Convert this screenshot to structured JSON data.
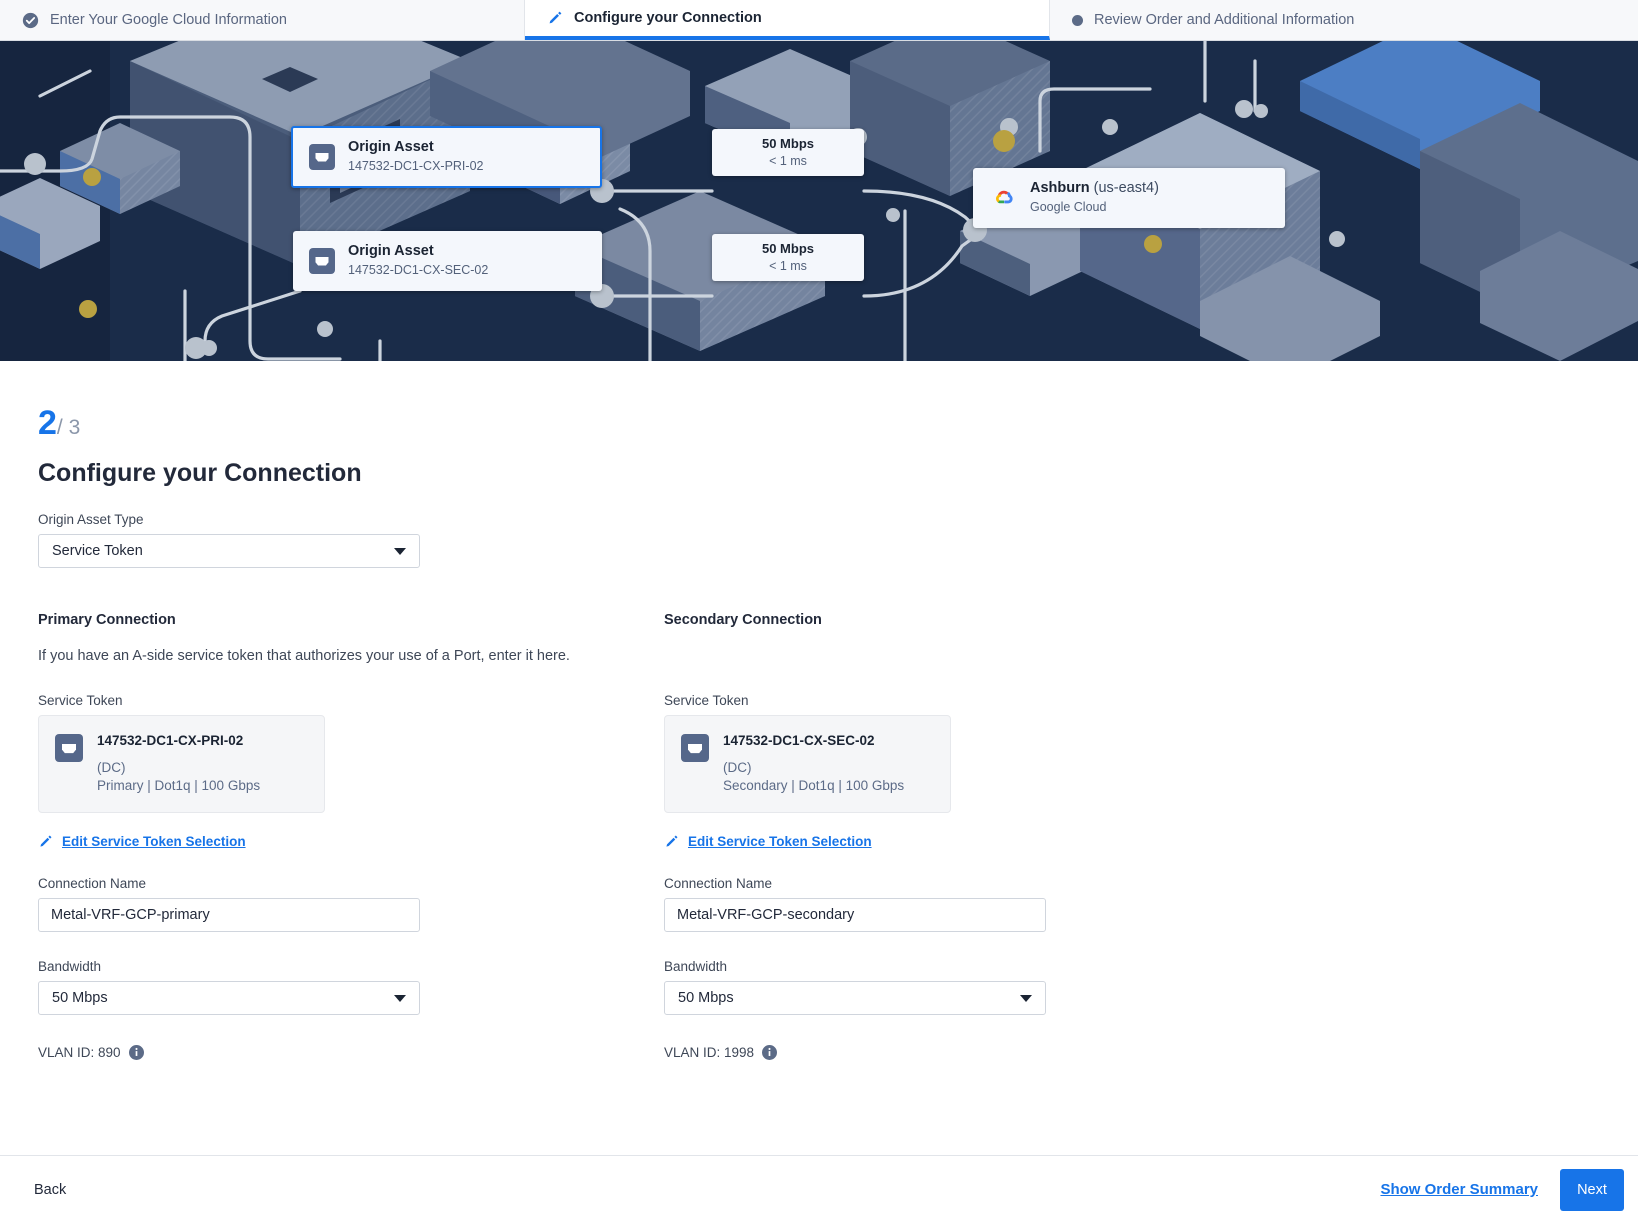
{
  "tabs": [
    {
      "label": "Enter Your Google Cloud Information",
      "icon": "check-circle-icon",
      "state": "complete"
    },
    {
      "label": "Configure your Connection",
      "icon": "pencil-icon",
      "state": "active"
    },
    {
      "label": "Review Order and Additional Information",
      "icon": "dot-icon",
      "state": "pending"
    }
  ],
  "hero": {
    "origin_a": {
      "title": "Origin Asset",
      "subtitle": "147532-DC1-CX-PRI-02",
      "icon": "port-icon"
    },
    "origin_b": {
      "title": "Origin Asset",
      "subtitle": "147532-DC1-CX-SEC-02",
      "icon": "port-icon"
    },
    "speed_a": {
      "bandwidth": "50 Mbps",
      "latency": "< 1 ms"
    },
    "speed_b": {
      "bandwidth": "50 Mbps",
      "latency": "< 1 ms"
    },
    "destination": {
      "name": "Ashburn",
      "region": "(us-east4)",
      "provider": "Google Cloud",
      "icon": "google-cloud-icon"
    }
  },
  "step": {
    "current": "2",
    "of": "/ 3",
    "title": "Configure your Connection"
  },
  "asset_type": {
    "label": "Origin Asset Type",
    "value": "Service Token"
  },
  "primary": {
    "heading": "Primary Connection",
    "description": "If you have an A-side service token that authorizes your use of a Port, enter it here.",
    "token_label": "Service Token",
    "token": {
      "name": "147532-DC1-CX-PRI-02",
      "location": "(DC)",
      "details": "Primary | Dot1q | 100 Gbps",
      "icon": "port-icon"
    },
    "edit_link": "Edit Service Token Selection",
    "connection_name_label": "Connection Name",
    "connection_name_value": "Metal-VRF-GCP-primary",
    "bandwidth_label": "Bandwidth",
    "bandwidth_value": "50 Mbps",
    "vlan": "VLAN ID: 890"
  },
  "secondary": {
    "heading": "Secondary Connection",
    "description": "",
    "token_label": "Service Token",
    "token": {
      "name": "147532-DC1-CX-SEC-02",
      "location": "(DC)",
      "details": "Secondary | Dot1q | 100 Gbps",
      "icon": "port-icon"
    },
    "edit_link": "Edit Service Token Selection",
    "connection_name_label": "Connection Name",
    "connection_name_value": "Metal-VRF-GCP-secondary",
    "bandwidth_label": "Bandwidth",
    "bandwidth_value": "50 Mbps",
    "vlan": "VLAN ID: 1998"
  },
  "footer": {
    "back": "Back",
    "summary": "Show Order Summary",
    "next": "Next"
  },
  "colors": {
    "accent_blue": "#1774e8",
    "banner_navy": "#16253f",
    "muted_text": "#5c6b87",
    "gold_node": "#c09a2e"
  }
}
